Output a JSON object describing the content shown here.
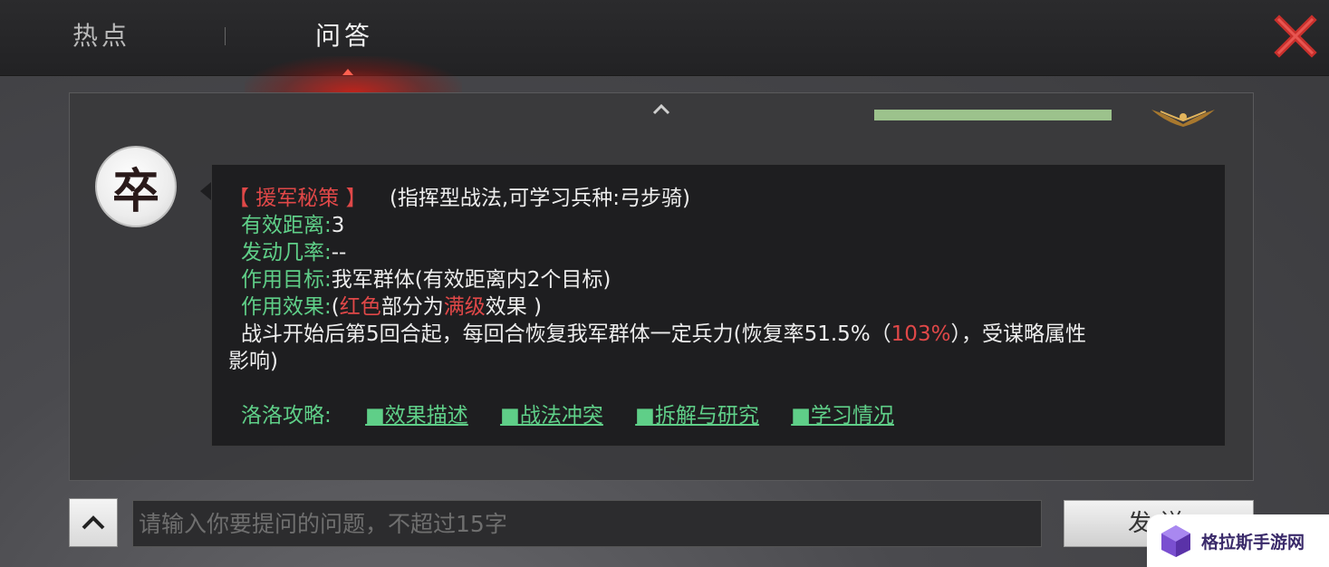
{
  "tabs": [
    {
      "label": "热点",
      "active": false
    },
    {
      "label": "问答",
      "active": true
    }
  ],
  "header": {
    "progress_fraction": 1.0
  },
  "avatar": {
    "glyph": "卒"
  },
  "skill": {
    "name": "【 援军秘策 】",
    "type": "(指挥型战法,可学习兵种:弓步骑)",
    "range_label": "有效距离:",
    "range_value": "3",
    "rate_label": "发动几率:",
    "rate_value": "--",
    "target_label": "作用目标:",
    "target_value": "我军群体(有效距离内2个目标)",
    "effect_label": "作用效果:",
    "effect_open": "(",
    "effect_red": "红色",
    "effect_mid": "部分为",
    "effect_full": "满级",
    "effect_end": "效果 )",
    "desc_part1": "战斗开始后第5回合起，每回合恢复我军群体一定兵力(恢复率51.5%（",
    "desc_red": "103%",
    "desc_part2": "），受谋略属性",
    "desc_line2": "影响)"
  },
  "links": {
    "label": "洛洛攻略:",
    "items": [
      "■效果描述",
      "■战法冲突",
      "■拆解与研究",
      "■学习情况"
    ]
  },
  "input": {
    "placeholder": "请输入你要提问的问题，不超过15字"
  },
  "send_label": "发送",
  "watermark": {
    "text": "格拉斯手游网"
  },
  "colors": {
    "highlight_red": "#e04848",
    "label_green": "#5fcf88",
    "progress_green": "#9cc28c"
  }
}
